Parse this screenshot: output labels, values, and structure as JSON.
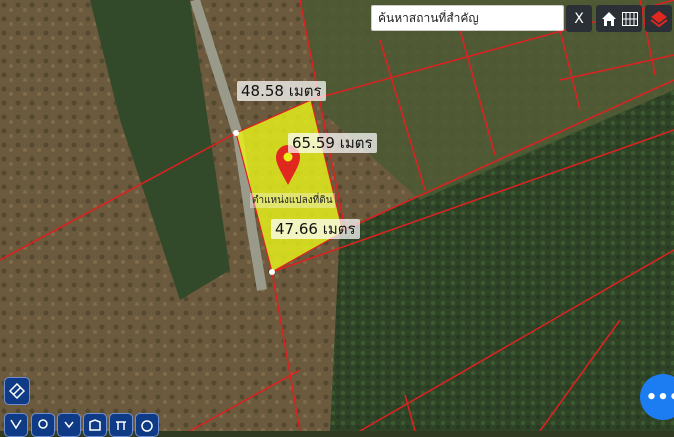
{
  "search": {
    "placeholder": "ค้นหาสถานที่สำคัญ",
    "clear_label": "X"
  },
  "measurements": {
    "top": "48.58 เมตร",
    "right": "65.59 เมตร",
    "bottom": "47.66 เมตร"
  },
  "plot": {
    "name": "ตำแหน่งแปลงที่ดิน",
    "fill_color": "#e8f21a",
    "boundary_color": "#e02020"
  },
  "fab": {
    "label": "•••"
  },
  "colors": {
    "toolbar_bg": "#2b2f36",
    "tool_bg": "#0f3a86",
    "fab_bg": "#1c7cf2"
  },
  "icons": {
    "top_bar": [
      "home-icon",
      "grid-icon",
      "layers-icon"
    ],
    "tools": [
      "draw-icon",
      "measure-icon",
      "pin-icon",
      "chevron-down-icon",
      "area-icon",
      "line-icon",
      "circle-icon"
    ]
  }
}
